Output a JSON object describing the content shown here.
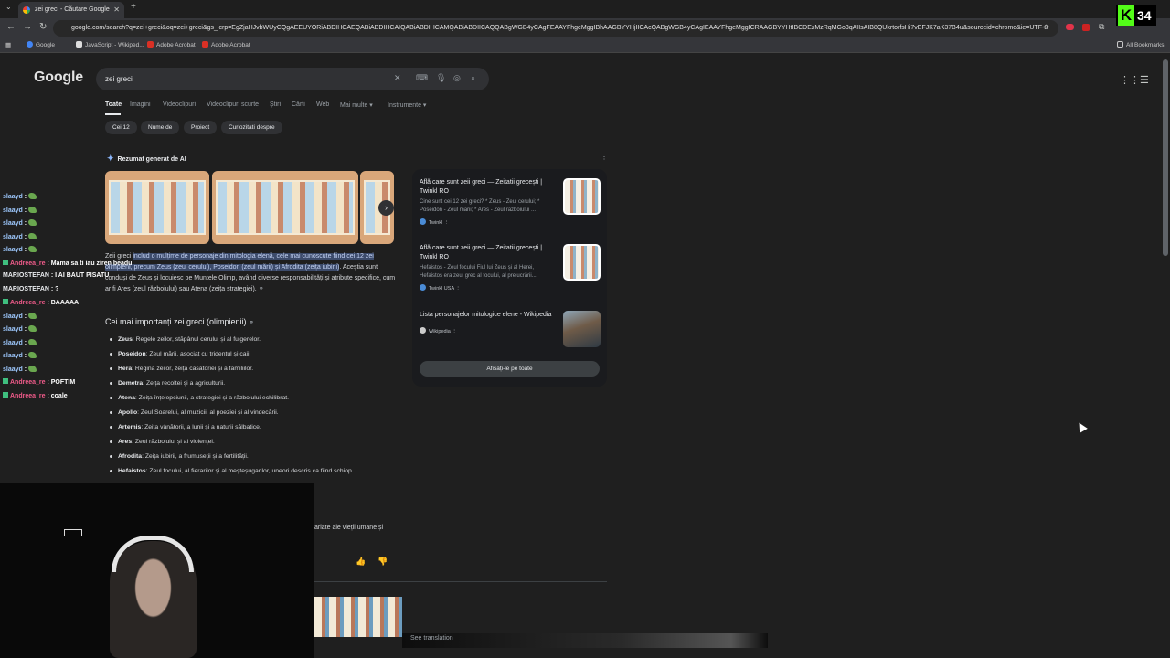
{
  "browser": {
    "tab_title": "zei greci - Căutare Google",
    "url": "google.com/search?q=zei+greci&oq=zei+greci&gs_lcrp=EgZjaHJvbWUyCQgAEEUYORiABDIHCAEQABiABDIHCAIQABiABDIHCAMQABiABDIICAQQABgWGB4yCAgFEAAYFhgeMggIBhAAGBYYHjIICAcQABgWGB4yCAgIEAAYFhgeMggICRAAGBYYHtIBCDEzMzRqMGo3qAIIsAIB8QUkrtorfsHi7vEFJK7aK37B4u&sourceid=chrome&ie=UTF-8",
    "bookmarks": [
      "Google",
      "JavaScript - Wikiped...",
      "Adobe Acrobat",
      "Adobe Acrobat"
    ],
    "all_bookmarks": "All Bookmarks"
  },
  "google": {
    "logo": "Google",
    "query": "zei greci",
    "tabs": [
      "Toate",
      "Imagini",
      "Videoclipuri",
      "Videoclipuri scurte",
      "Știri",
      "Cărți",
      "Web",
      "Mai multe",
      "Instrumente"
    ],
    "chips": [
      "Cei 12",
      "Nume de",
      "Proiect",
      "Curiozitati despre"
    ]
  },
  "ai_overview": {
    "heading": "Rezumat generat de AI",
    "intro_pre": "Zeii greci ",
    "intro_highlight": "includ o mulțime de personaje din mitologia elenă, cele mai cunoscute fiind cei 12 zei olimpieni, precum Zeus (zeul cerului), Poseidon (zeul mării) și Afrodita (zeița iubirii)",
    "intro_post": ". Aceștia sunt conduși de Zeus și locuiesc pe Muntele Olimp, având diverse responsabilități și atribute specifice, cum ar fi Ares (zeul războiului) sau Atena (zeița strategiei).",
    "gods_heading": "Cei mai importanți zei greci (olimpienii)",
    "gods": [
      {
        "name": "Zeus",
        "desc": ": Regele zeilor, stăpânul cerului și al fulgerelor."
      },
      {
        "name": "Poseidon",
        "desc": ": Zeul mării, asociat cu tridentul și caii."
      },
      {
        "name": "Hera",
        "desc": ": Regina zeilor, zeița căsătoriei și a familiilor."
      },
      {
        "name": "Demetra",
        "desc": ": Zeița recoltei și a agriculturii."
      },
      {
        "name": "Atena",
        "desc": ": Zeița înțelepciunii, a strategiei și a războiului echilibrat."
      },
      {
        "name": "Apollo",
        "desc": ": Zeul Soarelui, al muzicii, al poeziei și al vindecării."
      },
      {
        "name": "Artemis",
        "desc": ": Zeița vânătorii, a lunii și a naturii sălbatice."
      },
      {
        "name": "Ares",
        "desc": ": Zeul războiului și al violenței."
      },
      {
        "name": "Afrodita",
        "desc": ": Zeița iubirii, a frumuseții și a fertilității."
      },
      {
        "name": "Hefaistos",
        "desc": ": Zeul focului, al fierarilor și al meșteșugarilor, uneori descris ca fiind schiop."
      }
    ],
    "continuation": "ariate ale vieții umane și"
  },
  "sources": [
    {
      "title": "Află care sunt zeii greci — Zeitatii grecești | Twinkl RO",
      "snippet": "Cine sunt cei 12 zei greci? * Zeus - Zeul cerului; * Poseidon - Zeul mării; * Ares - Zeul războiului ...",
      "site": "Twinkl"
    },
    {
      "title": "Află care sunt zeii greci — Zeitatii grecești | Twinkl RO",
      "snippet": "Hefaistos - Zeul focului Fiul lui Zeus și al Herei, Hefaistos era zeul grec al focului, al prelucrării...",
      "site": "Twinkl USA"
    },
    {
      "title": "Lista personajelor mitologice elene - Wikipedia",
      "snippet": "",
      "site": "Wikipedia"
    }
  ],
  "show_all": "Afișați-le pe toate",
  "translation": "See translation",
  "stream": {
    "viewer_count": "34",
    "chat": [
      {
        "user": "slaayd",
        "color": "blue",
        "text": " :",
        "emote": true
      },
      {
        "user": "slaayd",
        "color": "blue",
        "text": " :",
        "emote": true
      },
      {
        "user": "slaayd",
        "color": "blue",
        "text": " :",
        "emote": true
      },
      {
        "user": "slaayd",
        "color": "blue",
        "text": " :",
        "emote": true
      },
      {
        "user": "slaayd",
        "color": "blue",
        "text": " :",
        "emote": true
      },
      {
        "user": "Andreea_re",
        "color": "pink",
        "text": " : Mama sa ti iau ziren beadu",
        "emote": false
      },
      {
        "user": "MARIOSTEFAN",
        "color": "white",
        "text": " : I AI BAUT PISATU",
        "emote": false
      },
      {
        "user": "MARIOSTEFAN",
        "color": "white",
        "text": " : ?",
        "emote": false
      },
      {
        "user": "Andreea_re",
        "color": "pink",
        "text": " : BAAAAA",
        "emote": false
      },
      {
        "user": "slaayd",
        "color": "blue",
        "text": " :",
        "emote": true
      },
      {
        "user": "slaayd",
        "color": "blue",
        "text": " :",
        "emote": true
      },
      {
        "user": "slaayd",
        "color": "blue",
        "text": " :",
        "emote": true
      },
      {
        "user": "slaayd",
        "color": "blue",
        "text": " :",
        "emote": true
      },
      {
        "user": "slaayd",
        "color": "blue",
        "text": " :",
        "emote": true
      },
      {
        "user": "Andreea_re",
        "color": "pink",
        "text": " : POFTIM",
        "emote": false
      },
      {
        "user": "Andreea_re",
        "color": "pink",
        "text": " : coale",
        "emote": false
      }
    ]
  }
}
